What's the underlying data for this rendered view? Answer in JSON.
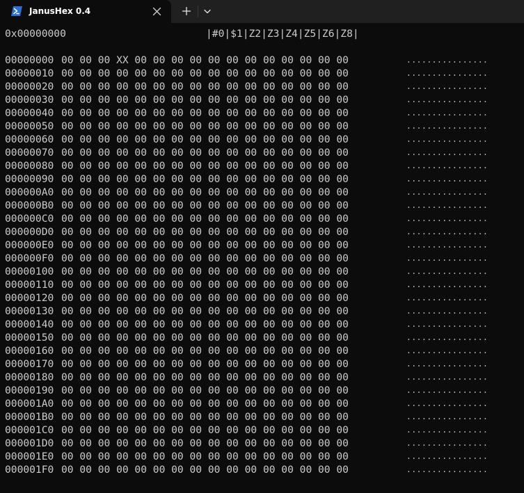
{
  "window": {
    "tab_title": "JanusHex 0.4",
    "tab_icon": "powershell-icon",
    "close_icon": "close-icon",
    "new_tab_icon": "plus-icon",
    "dropdown_icon": "chevron-down-icon",
    "colors": {
      "background": "#0c0c0c",
      "titlebar": "#202020",
      "text": "#cccccc",
      "icon_accent": "#2d6fd8"
    }
  },
  "header": {
    "offset": "0x00000000",
    "modes": "|#0|$1|Z2|Z3|Z4|Z5|Z6|Z8|"
  },
  "rows": [
    {
      "addr": "00000000",
      "bytes": "00 00 00 XX 00 00 00 00 00 00 00 00 00 00 00 00",
      "ascii": "................"
    },
    {
      "addr": "00000010",
      "bytes": "00 00 00 00 00 00 00 00 00 00 00 00 00 00 00 00",
      "ascii": "................"
    },
    {
      "addr": "00000020",
      "bytes": "00 00 00 00 00 00 00 00 00 00 00 00 00 00 00 00",
      "ascii": "................"
    },
    {
      "addr": "00000030",
      "bytes": "00 00 00 00 00 00 00 00 00 00 00 00 00 00 00 00",
      "ascii": "................"
    },
    {
      "addr": "00000040",
      "bytes": "00 00 00 00 00 00 00 00 00 00 00 00 00 00 00 00",
      "ascii": "................"
    },
    {
      "addr": "00000050",
      "bytes": "00 00 00 00 00 00 00 00 00 00 00 00 00 00 00 00",
      "ascii": "................"
    },
    {
      "addr": "00000060",
      "bytes": "00 00 00 00 00 00 00 00 00 00 00 00 00 00 00 00",
      "ascii": "................"
    },
    {
      "addr": "00000070",
      "bytes": "00 00 00 00 00 00 00 00 00 00 00 00 00 00 00 00",
      "ascii": "................"
    },
    {
      "addr": "00000080",
      "bytes": "00 00 00 00 00 00 00 00 00 00 00 00 00 00 00 00",
      "ascii": "................"
    },
    {
      "addr": "00000090",
      "bytes": "00 00 00 00 00 00 00 00 00 00 00 00 00 00 00 00",
      "ascii": "................"
    },
    {
      "addr": "000000A0",
      "bytes": "00 00 00 00 00 00 00 00 00 00 00 00 00 00 00 00",
      "ascii": "................"
    },
    {
      "addr": "000000B0",
      "bytes": "00 00 00 00 00 00 00 00 00 00 00 00 00 00 00 00",
      "ascii": "................"
    },
    {
      "addr": "000000C0",
      "bytes": "00 00 00 00 00 00 00 00 00 00 00 00 00 00 00 00",
      "ascii": "................"
    },
    {
      "addr": "000000D0",
      "bytes": "00 00 00 00 00 00 00 00 00 00 00 00 00 00 00 00",
      "ascii": "................"
    },
    {
      "addr": "000000E0",
      "bytes": "00 00 00 00 00 00 00 00 00 00 00 00 00 00 00 00",
      "ascii": "................"
    },
    {
      "addr": "000000F0",
      "bytes": "00 00 00 00 00 00 00 00 00 00 00 00 00 00 00 00",
      "ascii": "................"
    },
    {
      "addr": "00000100",
      "bytes": "00 00 00 00 00 00 00 00 00 00 00 00 00 00 00 00",
      "ascii": "................"
    },
    {
      "addr": "00000110",
      "bytes": "00 00 00 00 00 00 00 00 00 00 00 00 00 00 00 00",
      "ascii": "................"
    },
    {
      "addr": "00000120",
      "bytes": "00 00 00 00 00 00 00 00 00 00 00 00 00 00 00 00",
      "ascii": "................"
    },
    {
      "addr": "00000130",
      "bytes": "00 00 00 00 00 00 00 00 00 00 00 00 00 00 00 00",
      "ascii": "................"
    },
    {
      "addr": "00000140",
      "bytes": "00 00 00 00 00 00 00 00 00 00 00 00 00 00 00 00",
      "ascii": "................"
    },
    {
      "addr": "00000150",
      "bytes": "00 00 00 00 00 00 00 00 00 00 00 00 00 00 00 00",
      "ascii": "................"
    },
    {
      "addr": "00000160",
      "bytes": "00 00 00 00 00 00 00 00 00 00 00 00 00 00 00 00",
      "ascii": "................"
    },
    {
      "addr": "00000170",
      "bytes": "00 00 00 00 00 00 00 00 00 00 00 00 00 00 00 00",
      "ascii": "................"
    },
    {
      "addr": "00000180",
      "bytes": "00 00 00 00 00 00 00 00 00 00 00 00 00 00 00 00",
      "ascii": "................"
    },
    {
      "addr": "00000190",
      "bytes": "00 00 00 00 00 00 00 00 00 00 00 00 00 00 00 00",
      "ascii": "................"
    },
    {
      "addr": "000001A0",
      "bytes": "00 00 00 00 00 00 00 00 00 00 00 00 00 00 00 00",
      "ascii": "................"
    },
    {
      "addr": "000001B0",
      "bytes": "00 00 00 00 00 00 00 00 00 00 00 00 00 00 00 00",
      "ascii": "................"
    },
    {
      "addr": "000001C0",
      "bytes": "00 00 00 00 00 00 00 00 00 00 00 00 00 00 00 00",
      "ascii": "................"
    },
    {
      "addr": "000001D0",
      "bytes": "00 00 00 00 00 00 00 00 00 00 00 00 00 00 00 00",
      "ascii": "................"
    },
    {
      "addr": "000001E0",
      "bytes": "00 00 00 00 00 00 00 00 00 00 00 00 00 00 00 00",
      "ascii": "................"
    },
    {
      "addr": "000001F0",
      "bytes": "00 00 00 00 00 00 00 00 00 00 00 00 00 00 00 00",
      "ascii": "................"
    }
  ]
}
